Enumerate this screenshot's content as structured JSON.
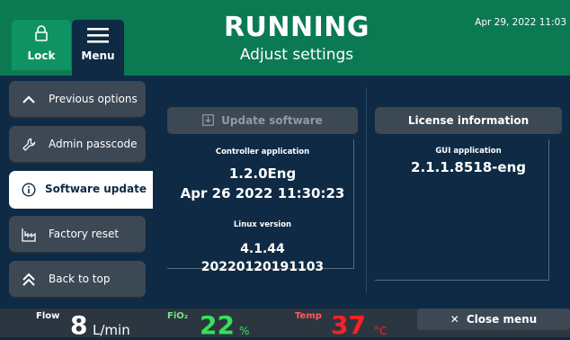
{
  "header": {
    "lock_label": "Lock",
    "menu_label": "Menu",
    "status": "RUNNING",
    "subtitle": "Adjust settings",
    "datetime": "Apr 29, 2022 11:03"
  },
  "sidebar": {
    "items": [
      {
        "label": "Previous options",
        "icon": "chevron-up-icon"
      },
      {
        "label": "Admin passcode",
        "icon": "wrench-icon"
      },
      {
        "label": "Software update",
        "icon": "info-icon",
        "active": true
      },
      {
        "label": "Factory reset",
        "icon": "factory-icon"
      },
      {
        "label": "Back to top",
        "icon": "double-chevron-up-icon"
      }
    ]
  },
  "main": {
    "update_button": "Update software",
    "license_button": "License information",
    "controller_caption": "Controller application",
    "controller_version": "1.2.0Eng",
    "controller_date": "Apr 26 2022 11:30:23",
    "linux_caption": "Linux version",
    "linux_version": "4.1.44",
    "linux_build": "20220120191103",
    "gui_caption": "GUI application",
    "gui_version": "2.1.1.8518-eng"
  },
  "footer": {
    "flow_label": "Flow",
    "flow_value": "8",
    "flow_unit": "L/min",
    "fio2_label": "FiO₂",
    "fio2_value": "22",
    "fio2_unit": "%",
    "temp_label": "Temp",
    "temp_value": "37",
    "temp_unit": "°C",
    "close_menu": "Close menu"
  },
  "colors": {
    "header_bg": "#0b7a52",
    "panel_bg": "#0e2a44",
    "button_bg": "#3d4855",
    "fio2": "#36e05a",
    "temp": "#ff2020"
  }
}
